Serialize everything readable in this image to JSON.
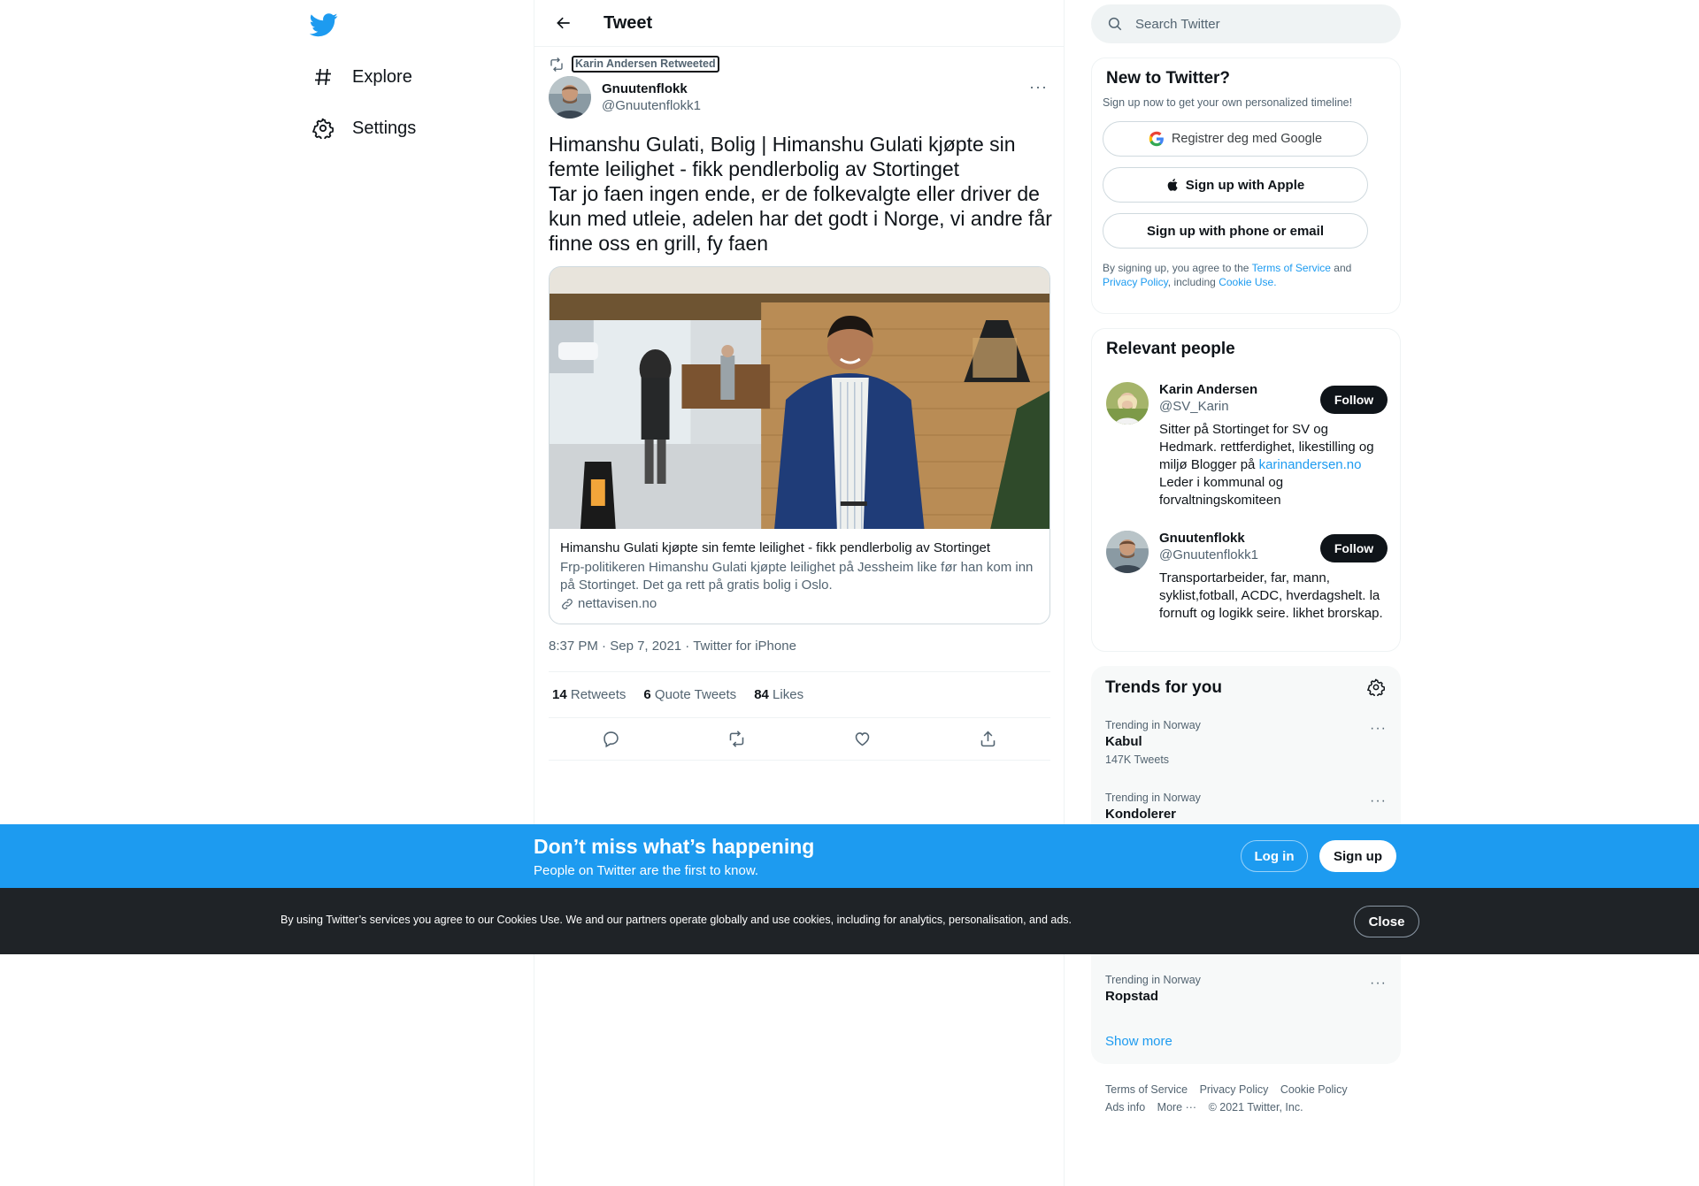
{
  "nav": {
    "logo": "twitter-bird-icon",
    "items": [
      {
        "label": "Explore",
        "icon": "hashtag-icon"
      },
      {
        "label": "Settings",
        "icon": "gear-icon"
      }
    ]
  },
  "header": {
    "title": "Tweet"
  },
  "tweet": {
    "retweeted_by": "Karin Andersen Retweeted",
    "author_name": "Gnuutenflokk",
    "author_handle": "@Gnuutenflokk1",
    "text_line1": "Himanshu Gulati, Bolig | Himanshu Gulati kjøpte sin femte leilighet - fikk pendlerbolig av Stortinget",
    "text_line2": "Tar jo faen ingen ende, er de folkevalgte eller driver de kun med utleie, adelen har det godt i Norge, vi andre får finne oss en grill, fy faen",
    "card": {
      "title": "Himanshu Gulati kjøpte sin femte leilighet - fikk pendlerbolig av Stortinget",
      "description": "Frp-politikeren Himanshu Gulati kjøpte leilighet på Jessheim like før han kom inn på Stortinget. Det ga rett på gratis bolig i Oslo.",
      "domain": "nettavisen.no"
    },
    "time": "8:37 PM",
    "date": "Sep 7, 2021",
    "source": "Twitter for iPhone",
    "retweets": "14",
    "retweets_label": "Retweets",
    "quotes": "6",
    "quotes_label": "Quote Tweets",
    "likes": "84",
    "likes_label": "Likes"
  },
  "search": {
    "placeholder": "Search Twitter"
  },
  "signup_panel": {
    "title": "New to Twitter?",
    "subtitle": "Sign up now to get your own personalized timeline!",
    "google": "Registrer deg med Google",
    "apple": "Sign up with Apple",
    "phone": "Sign up with phone or email",
    "legal_prefix": "By signing up, you agree to the",
    "terms": "Terms of Service",
    "and": "and",
    "privacy": "Privacy Policy",
    "including": ", including",
    "cookie": "Cookie Use."
  },
  "people": {
    "title": "Relevant people",
    "follow_label": "Follow",
    "list": [
      {
        "name": "Karin Andersen",
        "handle": "@SV_Karin",
        "bio_a": "Sitter på Stortinget for SV og Hedmark. rettferdighet, likestilling og miljø Blogger på",
        "bio_link": "karinandersen.no",
        "bio_b": "Leder i kommunal og forvaltningskomiteen"
      },
      {
        "name": "Gnuutenflokk",
        "handle": "@Gnuutenflokk1",
        "bio": "Transportarbeider, far, mann, syklist,fotball, ACDC, hverdagshelt. la fornuft og logikk seire. likhet brorskap."
      }
    ]
  },
  "trends": {
    "title": "Trends for you",
    "items": [
      {
        "category": "Trending in Norway",
        "name": "Kabul",
        "count": "147K Tweets"
      },
      {
        "category": "Trending in Norway",
        "name": "Kondolerer",
        "count": ""
      },
      {
        "category": "Trending in Norway",
        "name": "Ropstad",
        "count": ""
      }
    ],
    "show_more": "Show more"
  },
  "footer": {
    "terms": "Terms of Service",
    "privacy": "Privacy Policy",
    "cookie": "Cookie Policy",
    "ads": "Ads info",
    "more": "More ···",
    "copyright": "© 2021 Twitter, Inc."
  },
  "banner": {
    "title": "Don’t miss what’s happening",
    "subtitle": "People on Twitter are the first to know.",
    "login": "Log in",
    "signup": "Sign up"
  },
  "cookies": {
    "text": "By using Twitter’s services you agree to our Cookies Use. We and our partners operate globally and use cookies, including for analytics, personalisation, and ads.",
    "close": "Close"
  },
  "colors": {
    "accent": "#1d9bf0",
    "dark": "#0f1419",
    "muted": "#536471",
    "cookie_bg": "#1f2327"
  }
}
